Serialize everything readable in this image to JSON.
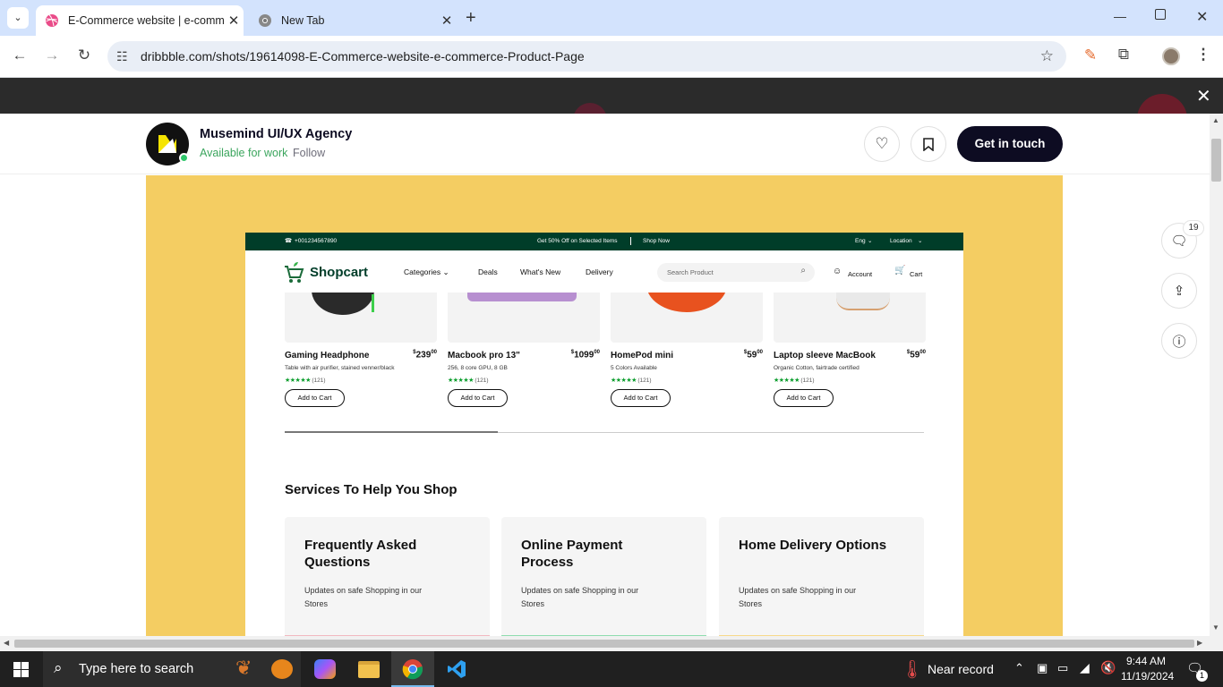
{
  "browser": {
    "tabs": [
      {
        "title": "E-Commerce website | e-comm",
        "active": true
      },
      {
        "title": "New Tab",
        "active": false
      }
    ],
    "url": "dribbble.com/shots/19614098-E-Commerce-website-e-commerce-Product-Page"
  },
  "shot": {
    "agency_name": "Musemind UI/UX Agency",
    "available_label": "Available for work",
    "follow_label": "Follow",
    "get_in_touch_label": "Get in touch",
    "comments_count": "19"
  },
  "site": {
    "phone": "+001234567890",
    "promo_text": "Get 50% Off on Selected Items",
    "shop_now": "Shop Now",
    "lang": "Eng",
    "location": "Location",
    "logo": "Shopcart",
    "nav": [
      "Categories",
      "Deals",
      "What's New",
      "Delivery"
    ],
    "search_placeholder": "Search Product",
    "account": "Account",
    "cart": "Cart",
    "add_to_cart": "Add to Cart",
    "products": [
      {
        "name": "Gaming Headphone",
        "currency": "$",
        "price": "239",
        "cents": "00",
        "desc": "Table with air purifier, stained venner/black",
        "reviews": "(121)"
      },
      {
        "name": "Macbook pro 13\"",
        "currency": "$",
        "price": "1099",
        "cents": "00",
        "desc": "256, 8 core GPU, 8 GB",
        "reviews": "(121)"
      },
      {
        "name": "HomePod mini",
        "currency": "$",
        "price": "59",
        "cents": "00",
        "desc": "5 Colors Available",
        "reviews": "(121)"
      },
      {
        "name": "Laptop sleeve MacBook",
        "currency": "$",
        "price": "59",
        "cents": "00",
        "desc": "Organic Cotton, fairtrade certified",
        "reviews": "(121)"
      }
    ],
    "services_title": "Services To Help You Shop",
    "services": [
      {
        "title": "Frequently Asked Questions",
        "desc": "Updates on safe Shopping in our Stores",
        "color": "#f2b8c0"
      },
      {
        "title": "Online Payment Process",
        "desc": "Updates on safe Shopping in our Stores",
        "color": "#8fdcae"
      },
      {
        "title": "Home Delivery Options",
        "desc": "Updates on safe Shopping in our Stores",
        "color": "#f7d98a"
      }
    ]
  },
  "taskbar": {
    "search_placeholder": "Type here to search",
    "weather": "Near record",
    "time": "9:44 AM",
    "date": "11/19/2024",
    "notification_count": "1"
  },
  "colors": {
    "shot_bg": "#f4cd62",
    "site_green": "#003d29",
    "tab_strip": "#d3e3fd"
  }
}
